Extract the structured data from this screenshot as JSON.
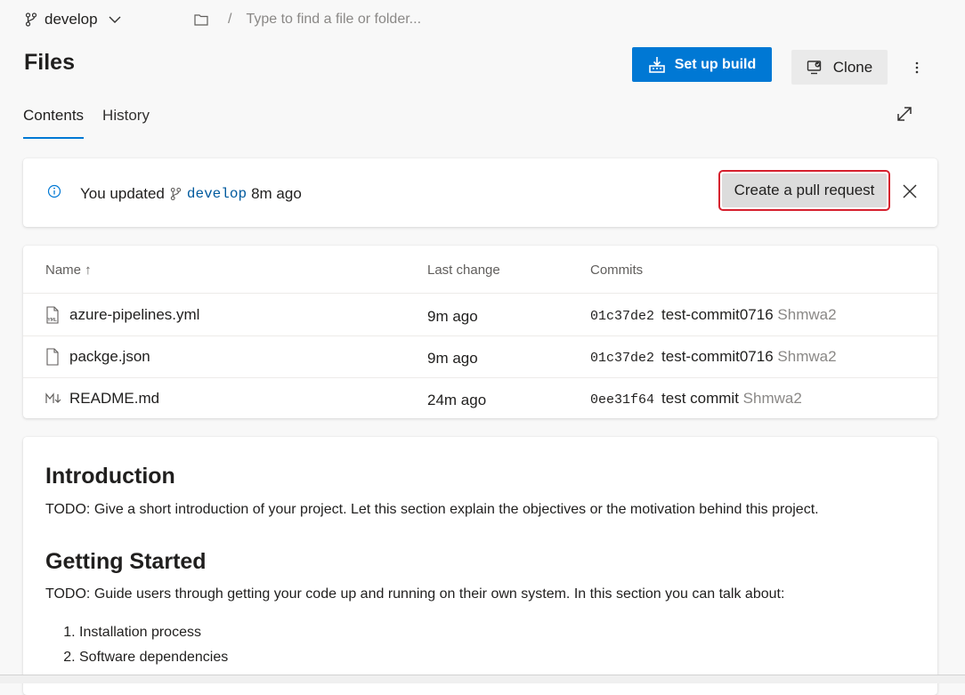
{
  "branch_picker": {
    "branch": "develop"
  },
  "path_input": {
    "placeholder": "Type to find a file or folder..."
  },
  "page": {
    "title": "Files"
  },
  "actions": {
    "setup_build": "Set up build",
    "clone": "Clone"
  },
  "tabs": [
    {
      "label": "Contents",
      "active": true
    },
    {
      "label": "History",
      "active": false
    }
  ],
  "banner": {
    "prefix": "You updated",
    "branch": "develop",
    "suffix": "8m ago",
    "pr_button": "Create a pull request"
  },
  "table": {
    "columns": [
      "Name ↑",
      "Last change",
      "Commits"
    ],
    "rows": [
      {
        "icon": "yml-file-icon",
        "name": "azure-pipelines.yml",
        "last_change": "9m ago",
        "hash": "01c37de2",
        "message": "test-commit0716",
        "author": "Shmwa2"
      },
      {
        "icon": "file-icon",
        "name": "packge.json",
        "last_change": "9m ago",
        "hash": "01c37de2",
        "message": "test-commit0716",
        "author": "Shmwa2"
      },
      {
        "icon": "markdown-file-icon",
        "name": "README.md",
        "last_change": "24m ago",
        "hash": "0ee31f64",
        "message": "test commit",
        "author": "Shmwa2"
      }
    ]
  },
  "readme": {
    "intro_heading": "Introduction",
    "intro_text": "TODO: Give a short introduction of your project. Let this section explain the objectives or the motivation behind this project.",
    "gs_heading": "Getting Started",
    "gs_text": "TODO: Guide users through getting your code up and running on their own system. In this section you can talk about:",
    "steps": [
      "Installation process",
      "Software dependencies"
    ]
  },
  "colors": {
    "accent": "#0078d4",
    "highlight": "#d6202e",
    "branch_link": "#005a9e"
  }
}
